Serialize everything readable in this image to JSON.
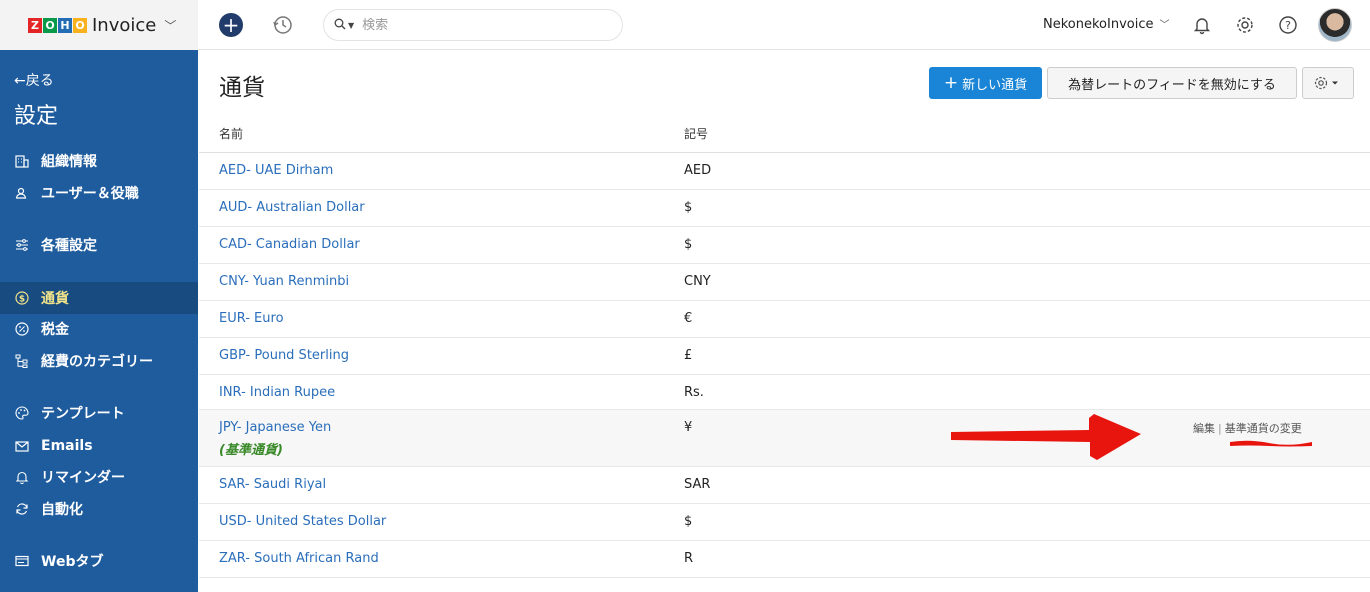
{
  "header": {
    "logo_letters": [
      "Z",
      "O",
      "H",
      "O"
    ],
    "logo_colors": [
      "#e42527",
      "#089949",
      "#226db4",
      "#f9b21d"
    ],
    "app_name": "Invoice",
    "search_placeholder": "検索",
    "org_name": "NekonekoInvoice"
  },
  "sidebar": {
    "back_label": "戻る",
    "title": "設定",
    "items": [
      {
        "label": "組織情報",
        "icon": "building-icon",
        "active": false
      },
      {
        "label": "ユーザー＆役職",
        "icon": "users-icon",
        "active": false
      },
      {
        "label": "各種設定",
        "icon": "sliders-icon",
        "active": false
      },
      {
        "label": "通貨",
        "icon": "currency-icon",
        "active": true
      },
      {
        "label": "税金",
        "icon": "percent-icon",
        "active": false
      },
      {
        "label": "経費のカテゴリー",
        "icon": "hierarchy-icon",
        "active": false
      },
      {
        "label": "テンプレート",
        "icon": "palette-icon",
        "active": false
      },
      {
        "label": "Emails",
        "icon": "mail-icon",
        "active": false
      },
      {
        "label": "リマインダー",
        "icon": "bell-icon",
        "active": false
      },
      {
        "label": "自動化",
        "icon": "refresh-icon",
        "active": false
      },
      {
        "label": "Webタブ",
        "icon": "browser-tab-icon",
        "active": false
      }
    ]
  },
  "main": {
    "title": "通貨",
    "new_currency_label": "新しい通貨",
    "disable_feed_label": "為替レートのフィードを無効にする",
    "columns": {
      "name": "名前",
      "symbol": "記号"
    },
    "rows": [
      {
        "name": "AED- UAE Dirham",
        "symbol": "AED"
      },
      {
        "name": "AUD- Australian Dollar",
        "symbol": "$"
      },
      {
        "name": "CAD- Canadian Dollar",
        "symbol": "$"
      },
      {
        "name": "CNY- Yuan Renminbi",
        "symbol": "CNY"
      },
      {
        "name": "EUR- Euro",
        "symbol": "€"
      },
      {
        "name": "GBP- Pound Sterling",
        "symbol": "£"
      },
      {
        "name": "INR- Indian Rupee",
        "symbol": "Rs."
      },
      {
        "name": "JPY- Japanese Yen",
        "symbol": "¥",
        "base": true,
        "base_label": "(基準通貨)",
        "edit_label": "編集",
        "change_base_label": "基準通貨の変更"
      },
      {
        "name": "SAR- Saudi Riyal",
        "symbol": "SAR"
      },
      {
        "name": "USD- United States Dollar",
        "symbol": "$"
      },
      {
        "name": "ZAR- South African Rand",
        "symbol": "R"
      }
    ]
  }
}
